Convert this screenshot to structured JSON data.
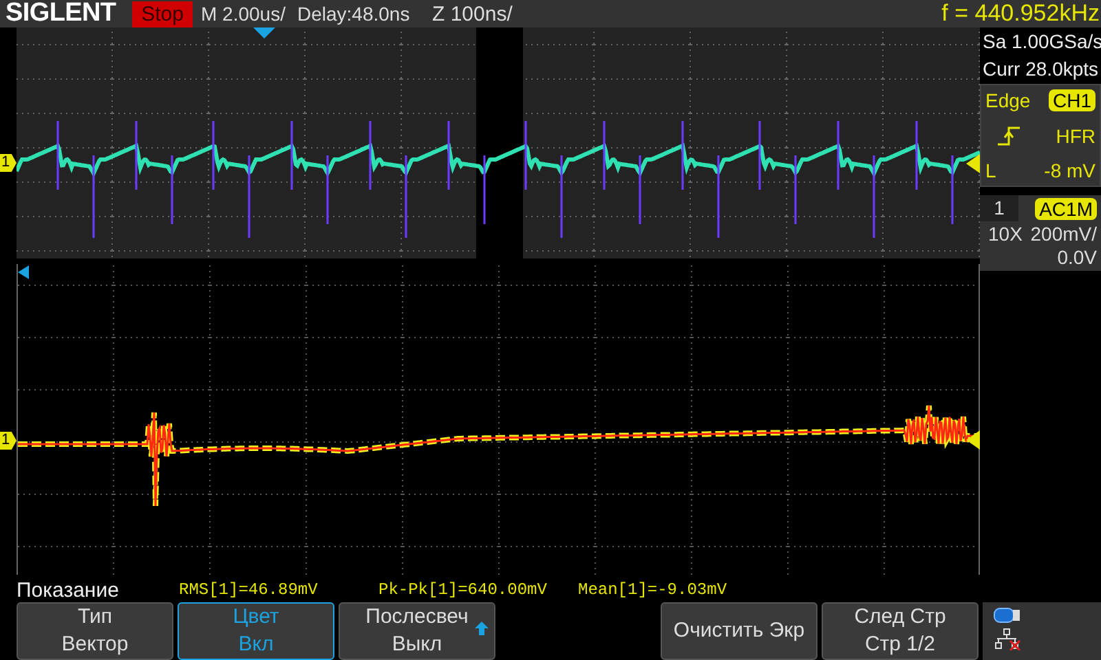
{
  "header": {
    "logo": "SIGLENT",
    "run_state": "Stop",
    "timebase": "M 2.00us/",
    "delay": "Delay:48.0ns",
    "zoom_timebase": "Z 100ns/",
    "frequency": "f = 440.952kHz"
  },
  "channel_markers": [
    "1",
    "1"
  ],
  "acquisition": {
    "sample_rate": "Sa 1.00GSa/s",
    "memory_depth": "Curr 28.0kpts"
  },
  "trigger": {
    "type": "Edge",
    "source": "CH1",
    "coupling": "HFR",
    "level_label": "L",
    "level": "-8 mV"
  },
  "channel": {
    "number": "1",
    "coupling": "AC1M",
    "probe": "10X",
    "scale": "200mV/",
    "offset": "0.0V"
  },
  "measurements": {
    "title": "Показание",
    "items": [
      "RMS[1]=46.89mV",
      "Pk-Pk[1]=640.00mV",
      "Mean[1]=-9.03mV"
    ]
  },
  "softkeys": {
    "left": [
      {
        "kind": "two_line",
        "line1": "Тип",
        "line2": "Вектор",
        "selected": false,
        "submenu": false
      },
      {
        "kind": "two_line",
        "line1": "Цвет",
        "line2": "Вкл",
        "selected": true,
        "submenu": false
      },
      {
        "kind": "two_line",
        "line1": "Послесвеч",
        "line2": "Выкл",
        "selected": false,
        "submenu": true
      }
    ],
    "right": [
      {
        "kind": "single",
        "line1": "Очистить Экр",
        "selected": false,
        "submenu": false
      },
      {
        "kind": "two_line",
        "line1": "След Стр",
        "line2": "Стр 1/2",
        "selected": false,
        "submenu": false
      }
    ]
  }
}
